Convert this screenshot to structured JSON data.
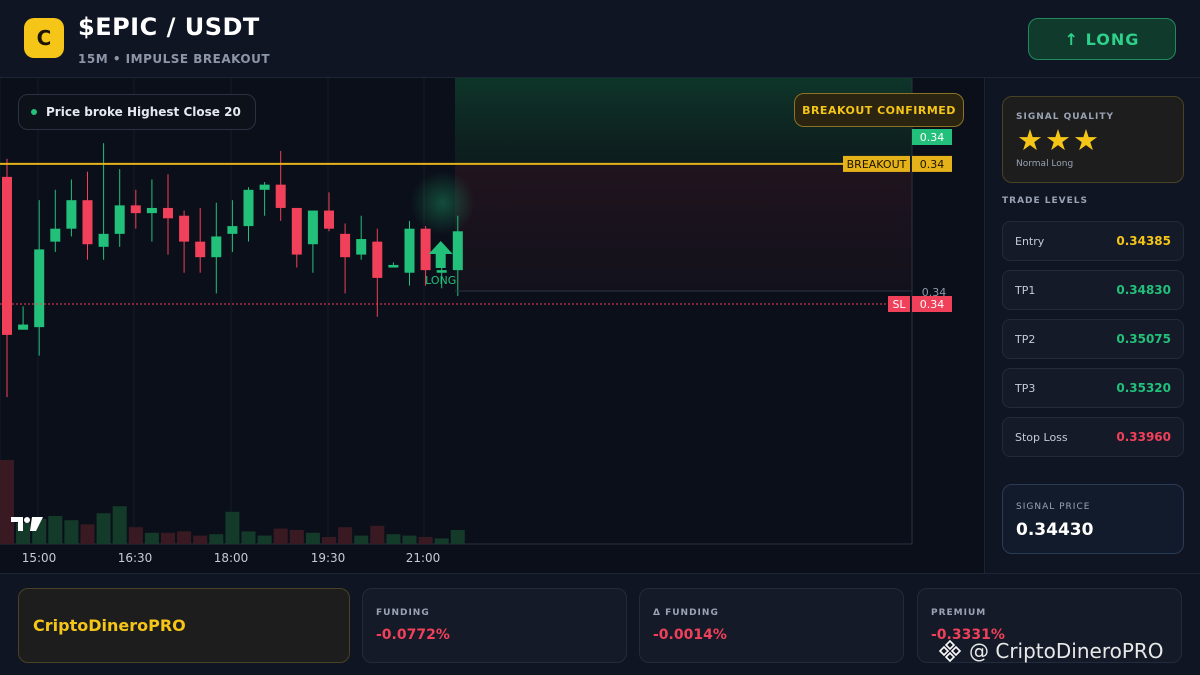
{
  "header": {
    "logo_letter": "C",
    "pair": "$EPIC / USDT",
    "subtitle": "15M • IMPULSE BREAKOUT",
    "direction_button": "↑ LONG"
  },
  "chart": {
    "legend_text": "Price broke Highest Close 20",
    "badge_text": "BREAKOUT CONFIRMED",
    "price_tags": {
      "last": "0.34",
      "breakout_label": "BREAKOUT",
      "breakout_value": "0.34",
      "axis_value": "0.34",
      "sl_label": "SL",
      "sl_value": "0.34"
    },
    "signal_marker_label": "LONG",
    "time_labels": [
      "15:00",
      "16:30",
      "18:00",
      "19:30",
      "21:00"
    ],
    "colors": {
      "up": "#22c07a",
      "down": "#f0405a",
      "breakout_line": "#e6b21a",
      "sl_line": "#f0405a"
    }
  },
  "chart_data": {
    "type": "candlestick",
    "x": [
      "14:45",
      "15:00",
      "15:15",
      "15:30",
      "15:45",
      "16:00",
      "16:15",
      "16:30",
      "16:45",
      "17:00",
      "17:15",
      "17:30",
      "17:45",
      "18:00",
      "18:15",
      "18:30",
      "18:45",
      "19:00",
      "19:15",
      "19:30",
      "19:45",
      "20:00",
      "20:15",
      "20:30",
      "20:45",
      "21:00",
      "21:15",
      "21:30",
      "21:45"
    ],
    "candles": [
      {
        "o": 0.34395,
        "h": 0.34402,
        "l": 0.3431,
        "c": 0.34334,
        "v": 0.6
      },
      {
        "o": 0.34336,
        "h": 0.34345,
        "l": 0.34337,
        "c": 0.34338,
        "v": 0.15
      },
      {
        "o": 0.34337,
        "h": 0.34386,
        "l": 0.34326,
        "c": 0.34367,
        "v": 0.18
      },
      {
        "o": 0.3437,
        "h": 0.3439,
        "l": 0.34366,
        "c": 0.34375,
        "v": 0.2
      },
      {
        "o": 0.34375,
        "h": 0.34394,
        "l": 0.34372,
        "c": 0.34386,
        "v": 0.17
      },
      {
        "o": 0.34386,
        "h": 0.34397,
        "l": 0.34363,
        "c": 0.34369,
        "v": 0.14
      },
      {
        "o": 0.34368,
        "h": 0.34408,
        "l": 0.34363,
        "c": 0.34373,
        "v": 0.22
      },
      {
        "o": 0.34373,
        "h": 0.34398,
        "l": 0.34368,
        "c": 0.34384,
        "v": 0.27
      },
      {
        "o": 0.34384,
        "h": 0.3439,
        "l": 0.34375,
        "c": 0.34381,
        "v": 0.12
      },
      {
        "o": 0.34381,
        "h": 0.34394,
        "l": 0.3437,
        "c": 0.34383,
        "v": 0.08
      },
      {
        "o": 0.34383,
        "h": 0.34396,
        "l": 0.34365,
        "c": 0.34379,
        "v": 0.08
      },
      {
        "o": 0.3438,
        "h": 0.34382,
        "l": 0.34358,
        "c": 0.3437,
        "v": 0.09
      },
      {
        "o": 0.3437,
        "h": 0.34383,
        "l": 0.34358,
        "c": 0.34364,
        "v": 0.06
      },
      {
        "o": 0.34364,
        "h": 0.34385,
        "l": 0.3435,
        "c": 0.34372,
        "v": 0.07
      },
      {
        "o": 0.34373,
        "h": 0.34386,
        "l": 0.34366,
        "c": 0.34376,
        "v": 0.23
      },
      {
        "o": 0.34376,
        "h": 0.34391,
        "l": 0.3437,
        "c": 0.3439,
        "v": 0.09
      },
      {
        "o": 0.3439,
        "h": 0.34393,
        "l": 0.3438,
        "c": 0.34392,
        "v": 0.06
      },
      {
        "o": 0.34392,
        "h": 0.34405,
        "l": 0.34378,
        "c": 0.34383,
        "v": 0.11
      },
      {
        "o": 0.34383,
        "h": 0.34383,
        "l": 0.3436,
        "c": 0.34365,
        "v": 0.1
      },
      {
        "o": 0.34369,
        "h": 0.34381,
        "l": 0.34358,
        "c": 0.34382,
        "v": 0.08
      },
      {
        "o": 0.34382,
        "h": 0.34389,
        "l": 0.34374,
        "c": 0.34375,
        "v": 0.05
      },
      {
        "o": 0.34373,
        "h": 0.34377,
        "l": 0.3435,
        "c": 0.34364,
        "v": 0.12
      },
      {
        "o": 0.34365,
        "h": 0.3438,
        "l": 0.34363,
        "c": 0.34371,
        "v": 0.06
      },
      {
        "o": 0.3437,
        "h": 0.34375,
        "l": 0.34341,
        "c": 0.34356,
        "v": 0.13
      },
      {
        "o": 0.3436,
        "h": 0.34362,
        "l": 0.3436,
        "c": 0.34361,
        "v": 0.07
      },
      {
        "o": 0.34358,
        "h": 0.34378,
        "l": 0.34353,
        "c": 0.34375,
        "v": 0.06
      },
      {
        "o": 0.34375,
        "h": 0.34376,
        "l": 0.34353,
        "c": 0.34359,
        "v": 0.05
      },
      {
        "o": 0.34358,
        "h": 0.34364,
        "l": 0.34352,
        "c": 0.34359,
        "v": 0.04
      },
      {
        "o": 0.34359,
        "h": 0.3438,
        "l": 0.34349,
        "c": 0.34374,
        "v": 0.1
      }
    ],
    "breakout_level": 0.344,
    "stop_loss": 0.3396
  },
  "sidebar": {
    "quality": {
      "title": "SIGNAL QUALITY",
      "stars": "★★★",
      "subtitle": "Normal Long"
    },
    "trade_levels_title": "TRADE LEVELS",
    "levels": [
      {
        "label": "Entry",
        "value": "0.34385",
        "color": "#f5c518"
      },
      {
        "label": "TP1",
        "value": "0.34830",
        "color": "#22c07a"
      },
      {
        "label": "TP2",
        "value": "0.35075",
        "color": "#22c07a"
      },
      {
        "label": "TP3",
        "value": "0.35320",
        "color": "#22c07a"
      },
      {
        "label": "Stop Loss",
        "value": "0.33960",
        "color": "#f0405a"
      }
    ],
    "signal_price": {
      "title": "SIGNAL PRICE",
      "value": "0.34430"
    }
  },
  "footer": {
    "brand": "CriptoDineroPRO",
    "metrics": [
      {
        "label": "FUNDING",
        "value": "-0.0772%"
      },
      {
        "label": "Δ FUNDING",
        "value": "-0.0014%"
      },
      {
        "label": "PREMIUM",
        "value": "-0.3331%"
      }
    ],
    "watermark": "@ CriptoDineroPRO"
  }
}
